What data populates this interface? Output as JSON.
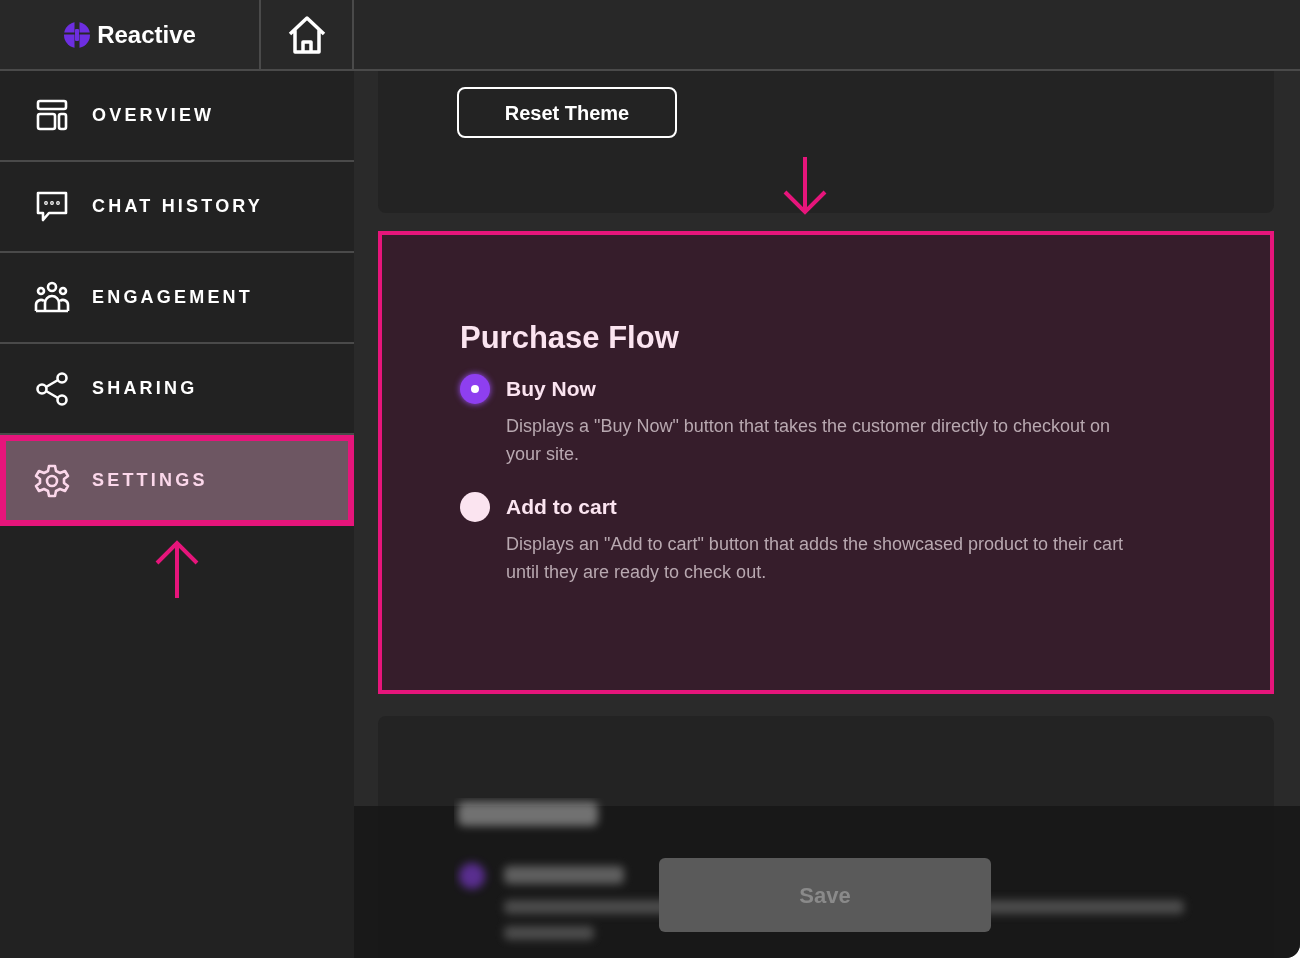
{
  "brand": {
    "name": "Reactive"
  },
  "sidebar": {
    "items": [
      {
        "label": "OVERVIEW",
        "kind": "overview",
        "selected": false
      },
      {
        "label": "CHAT HISTORY",
        "kind": "chat",
        "selected": false
      },
      {
        "label": "ENGAGEMENT",
        "kind": "people",
        "selected": false
      },
      {
        "label": "SHARING",
        "kind": "share",
        "selected": false
      },
      {
        "label": "SETTINGS",
        "kind": "gear",
        "selected": true
      }
    ]
  },
  "theme_card": {
    "button": "Reset Theme"
  },
  "purchase_flow": {
    "title": "Purchase Flow",
    "highlighted": true,
    "options": [
      {
        "label": "Buy Now",
        "description": "Displays a \"Buy Now\" button that takes the customer directly to checkout on your site.",
        "selected": true
      },
      {
        "label": "Add to cart",
        "description": "Displays an \"Add to cart\" button that adds the showcased product to their cart until they are ready to check out.",
        "selected": false
      }
    ]
  },
  "save_button": {
    "label": "Save",
    "disabled": true
  }
}
